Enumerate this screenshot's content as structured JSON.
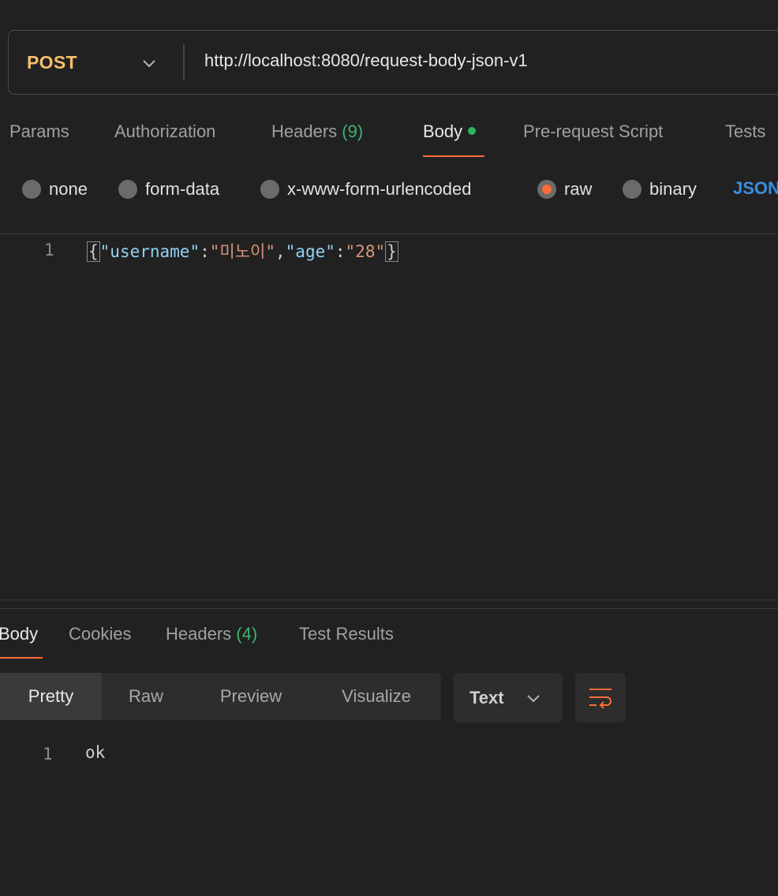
{
  "request": {
    "method": "POST",
    "url": "http://localhost:8080/request-body-json-v1"
  },
  "request_tabs": {
    "params": "Params",
    "authorization": "Authorization",
    "headers_label": "Headers",
    "headers_count": "(9)",
    "body": "Body",
    "pre_request": "Pre-request Script",
    "tests": "Tests"
  },
  "body_types": {
    "none": "none",
    "form_data": "form-data",
    "urlencoded": "x-www-form-urlencoded",
    "raw": "raw",
    "binary": "binary",
    "selected": "raw",
    "format": "JSON"
  },
  "editor": {
    "line_number": "1",
    "open_brace": "{",
    "key1": "\"username\"",
    "colon": ":",
    "value1": "\"미노이\"",
    "comma": ",",
    "key2": "\"age\"",
    "value2": "\"28\"",
    "close_brace": "}"
  },
  "response_tabs": {
    "body": "Body",
    "cookies": "Cookies",
    "headers_label": "Headers",
    "headers_count": "(4)",
    "test_results": "Test Results"
  },
  "response_view": {
    "pretty": "Pretty",
    "raw": "Raw",
    "preview": "Preview",
    "visualize": "Visualize",
    "format": "Text"
  },
  "response": {
    "line_number": "1",
    "text": "ok"
  },
  "colors": {
    "accent": "#ff6c37",
    "method": "#f5c06a",
    "count": "#3cb371",
    "json_link": "#3a8fe0"
  }
}
